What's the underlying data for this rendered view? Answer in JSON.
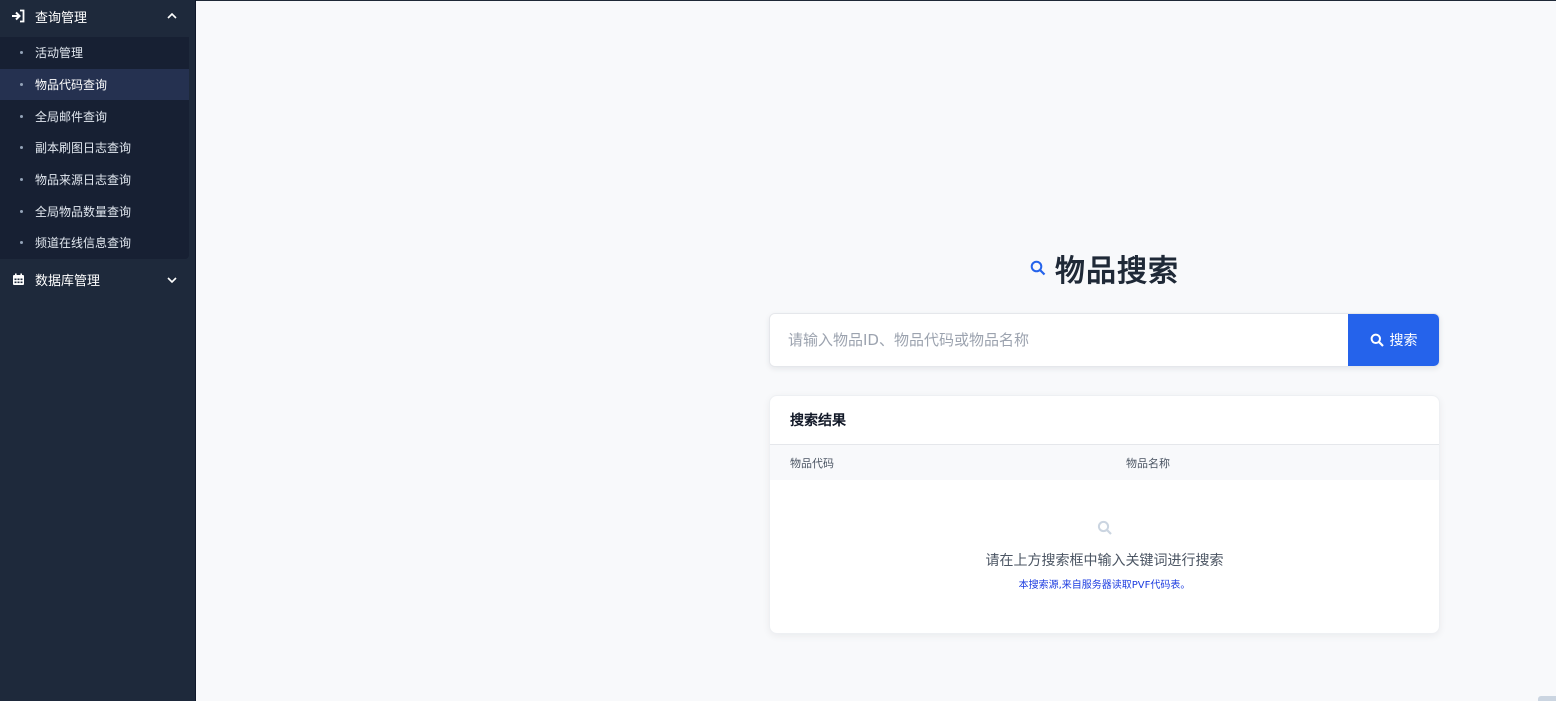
{
  "sidebar": {
    "groups": [
      {
        "label": "查询管理",
        "icon": "sign-in-icon",
        "expanded": true,
        "items": [
          {
            "label": "活动管理"
          },
          {
            "label": "物品代码查询",
            "active": true
          },
          {
            "label": "全局邮件查询"
          },
          {
            "label": "副本刷图日志查询"
          },
          {
            "label": "物品来源日志查询"
          },
          {
            "label": "全局物品数量查询"
          },
          {
            "label": "频道在线信息查询"
          }
        ]
      },
      {
        "label": "数据库管理",
        "icon": "calendar-icon",
        "expanded": false
      }
    ]
  },
  "main": {
    "title": "物品搜索",
    "search": {
      "placeholder": "请输入物品ID、物品代码或物品名称",
      "value": "",
      "button_label": "搜索"
    },
    "results": {
      "title": "搜索结果",
      "columns": [
        "物品代码",
        "物品名称"
      ],
      "empty_message": "请在上方搜索框中输入关键词进行搜索",
      "empty_note": "本搜索源,来自服务器读取PVF代码表。"
    }
  },
  "colors": {
    "sidebar_bg": "#1e293b",
    "accent": "#2563eb",
    "note_blue": "#1d3de0"
  }
}
